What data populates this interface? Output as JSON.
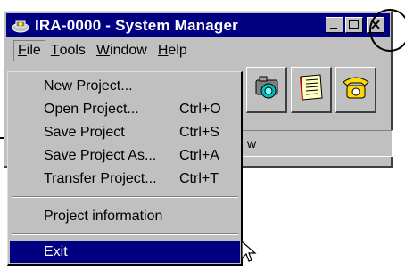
{
  "window": {
    "title": "IRA-0000 - System Manager"
  },
  "title_buttons": [
    "minimize",
    "maximize",
    "close"
  ],
  "menubar": {
    "items": [
      {
        "label": "File",
        "underline": "F",
        "rest": "ile"
      },
      {
        "label": "Tools",
        "underline": "T",
        "rest": "ools"
      },
      {
        "label": "Window",
        "underline": "W",
        "rest": "indow"
      },
      {
        "label": "Help",
        "underline": "H",
        "rest": "elp"
      }
    ]
  },
  "file_menu": {
    "items": [
      {
        "label": "New Project...",
        "shortcut": ""
      },
      {
        "label": "Open Project...",
        "shortcut": "Ctrl+O"
      },
      {
        "label": "Save Project",
        "shortcut": "Ctrl+S"
      },
      {
        "label": "Save Project As...",
        "shortcut": "Ctrl+A"
      },
      {
        "label": "Transfer Project...",
        "shortcut": "Ctrl+T"
      },
      {
        "label": "Project information",
        "shortcut": ""
      },
      {
        "label": "Exit",
        "shortcut": ""
      }
    ]
  },
  "toolbar": {
    "icons": [
      "camera-icon",
      "document-icon",
      "telephone-icon"
    ]
  },
  "statusbar": {
    "text": "w"
  },
  "colors": {
    "titlebar": "#000080",
    "face": "#c0c0c0",
    "highlight": "#000080"
  }
}
